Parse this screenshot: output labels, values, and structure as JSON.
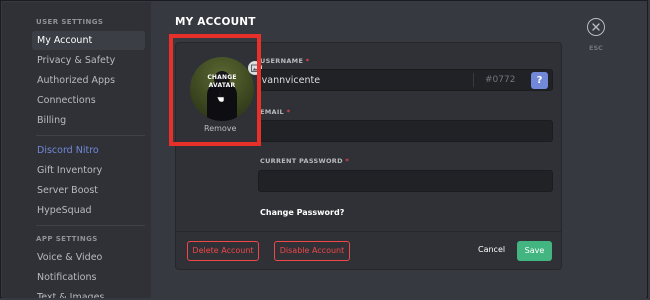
{
  "sidebar": {
    "user_settings_header": "USER SETTINGS",
    "items": [
      {
        "label": "My Account"
      },
      {
        "label": "Privacy & Safety"
      },
      {
        "label": "Authorized Apps"
      },
      {
        "label": "Connections"
      },
      {
        "label": "Billing"
      }
    ],
    "nitro_items": [
      {
        "label": "Discord Nitro"
      },
      {
        "label": "Gift Inventory"
      },
      {
        "label": "Server Boost"
      },
      {
        "label": "HypeSquad"
      }
    ],
    "app_settings_header": "APP SETTINGS",
    "app_items": [
      {
        "label": "Voice & Video"
      },
      {
        "label": "Notifications"
      },
      {
        "label": "Text & Images"
      }
    ],
    "active_item": "My Account"
  },
  "main": {
    "title": "MY ACCOUNT",
    "close_icon": "close-icon",
    "esc_label": "ESC"
  },
  "account": {
    "avatar_overlay_line1": "CHANGE",
    "avatar_overlay_line2": "AVATAR",
    "remove_label": "Remove",
    "username_label": "USERNAME",
    "username_value": "jvannvicente",
    "discriminator": "#0772",
    "help_button": "?",
    "email_label": "EMAIL",
    "email_value": "",
    "password_label": "CURRENT PASSWORD",
    "password_value": "",
    "required_marker": "*",
    "change_password": "Change Password?"
  },
  "actions": {
    "delete_account": "Delete Account",
    "disable_account": "Disable Account",
    "cancel": "Cancel",
    "save": "Save"
  },
  "colors": {
    "highlight": "#e8302a",
    "save": "#43b581",
    "danger": "#f04747",
    "accent": "#7289da"
  }
}
